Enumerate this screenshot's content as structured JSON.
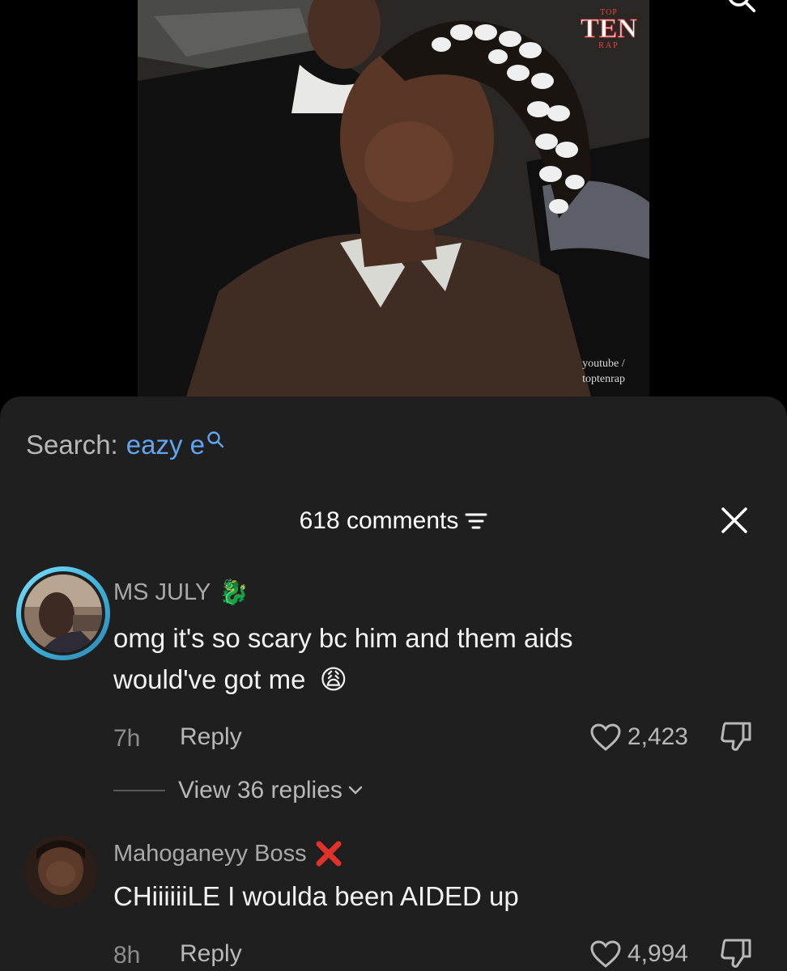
{
  "video": {
    "watermark": {
      "top": "TOP",
      "main": "TEN",
      "bottom": "RAP"
    },
    "credit_line1": "youtube /",
    "credit_line2": "toptenrap"
  },
  "search": {
    "label": "Search:",
    "term": "eazy e"
  },
  "comments_header": {
    "count_label": "618 comments"
  },
  "comments": [
    {
      "username": "MS JULY",
      "badge_emoji": "🐉",
      "text_line1": "omg it's so scary bc him and them aids",
      "text_line2": "would've got me",
      "emoji": "😩",
      "time": "7h",
      "reply_label": "Reply",
      "likes": "2,423",
      "view_replies": "View 36 replies"
    },
    {
      "username": "Mahoganeyy Boss",
      "badge_emoji": "❌",
      "text_line1": "CHiiiiiiLE I woulda been AIDED up",
      "time": "8h",
      "reply_label": "Reply",
      "likes": "4,994"
    }
  ],
  "colors": {
    "sheet_bg": "#1f1f1f",
    "search_term": "#5fa5f0",
    "avatar_ring": "#3fb3d9",
    "badge_red": "#e0312b"
  },
  "icons": [
    "search-icon",
    "filter-icon",
    "close-icon",
    "heart-icon",
    "dislike-icon",
    "chevron-down-icon"
  ]
}
